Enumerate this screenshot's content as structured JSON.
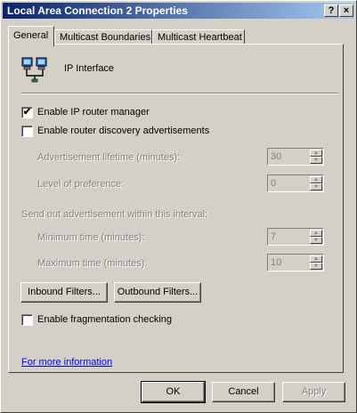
{
  "window": {
    "title": "Local Area Connection 2 Properties",
    "help_btn": "?",
    "close_btn": "×"
  },
  "tabs": [
    {
      "label": "General",
      "active": true
    },
    {
      "label": "Multicast Boundaries",
      "active": false
    },
    {
      "label": "Multicast Heartbeat",
      "active": false
    }
  ],
  "general": {
    "interface_label": "IP Interface",
    "enable_ip_router_manager": {
      "label": "Enable IP router manager",
      "checked": true,
      "mark": "✔"
    },
    "enable_router_discovery": {
      "label": "Enable router discovery advertisements",
      "checked": false
    },
    "adv_lifetime": {
      "label": "Advertisement lifetime (minutes):",
      "value": "30"
    },
    "level_of_preference": {
      "label": "Level of preference:",
      "value": "0"
    },
    "send_interval_label": "Send out advertisement within this interval:",
    "min_time": {
      "label": "Minimum time (minutes):",
      "value": "7"
    },
    "max_time": {
      "label": "Maximum time (minutes):",
      "value": "10"
    },
    "inbound_filters": "Inbound Filters...",
    "outbound_filters": "Outbound Filters...",
    "enable_fragmentation": {
      "label": "Enable fragmentation checking",
      "checked": false
    },
    "more_info_link": "For more information"
  },
  "footer": {
    "ok": "OK",
    "cancel": "Cancel",
    "apply": "Apply"
  },
  "spin": {
    "up": "▲",
    "down": "▼"
  }
}
